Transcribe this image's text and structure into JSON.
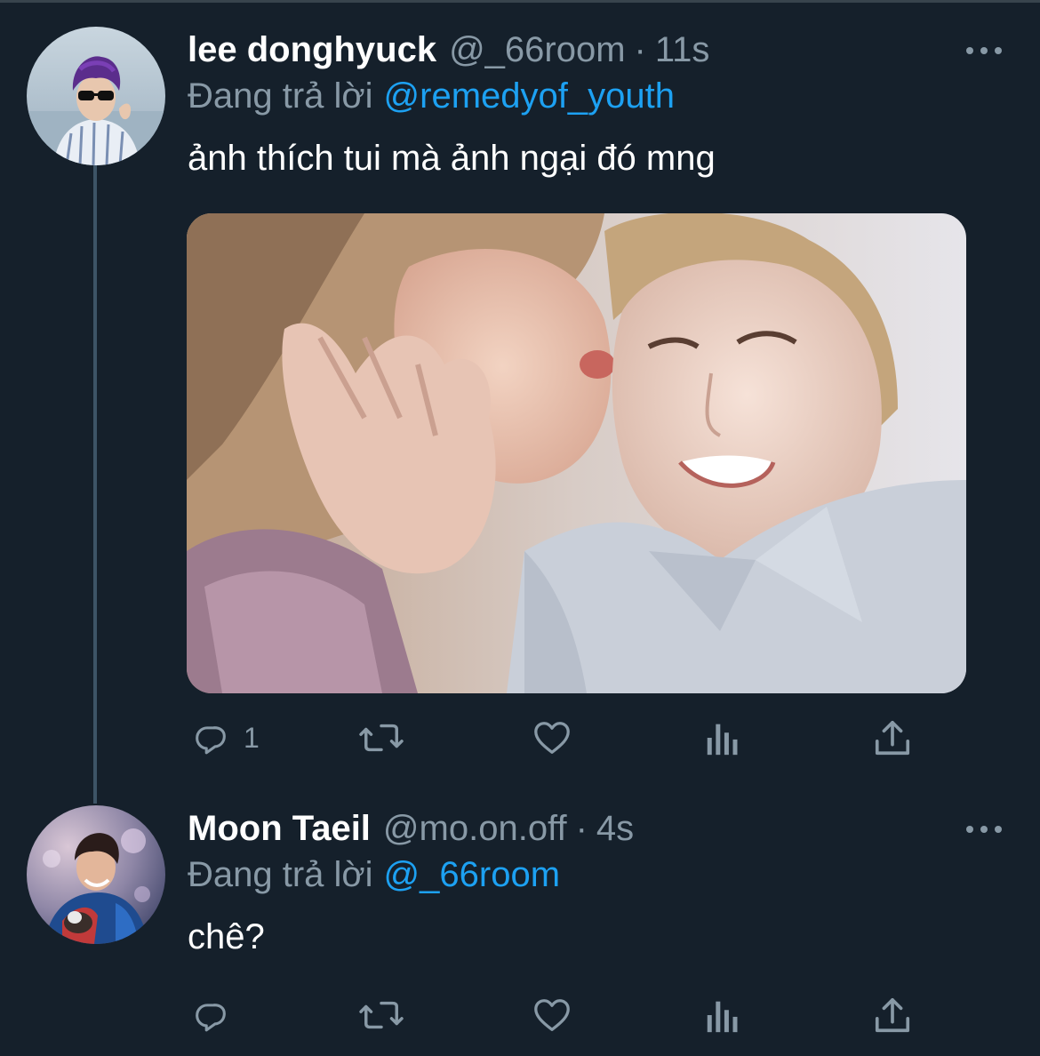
{
  "colors": {
    "background": "#15202b",
    "text": "#ffffff",
    "secondary": "#8899a6",
    "link": "#1da1f2",
    "thread_line": "#3d5466"
  },
  "tweets": [
    {
      "name": "lee donghyuck",
      "handle": "@_66room",
      "separator": "·",
      "time": "11s",
      "reply_prefix": "Đang trả lời",
      "reply_to": "@remedyof_youth",
      "text": "ảnh thích tui mà ảnh ngại đó mng",
      "has_media": true,
      "reply_count": "1",
      "icons": [
        "reply-icon",
        "retweet-icon",
        "like-icon",
        "analytics-icon",
        "share-icon",
        "more-icon"
      ]
    },
    {
      "name": "Moon Taeil",
      "handle": "@mo.on.off",
      "separator": "·",
      "time": "4s",
      "reply_prefix": "Đang trả lời",
      "reply_to": "@_66room",
      "text": "chê?",
      "has_media": false,
      "reply_count": "",
      "icons": [
        "reply-icon",
        "retweet-icon",
        "like-icon",
        "analytics-icon",
        "share-icon",
        "more-icon"
      ]
    }
  ]
}
